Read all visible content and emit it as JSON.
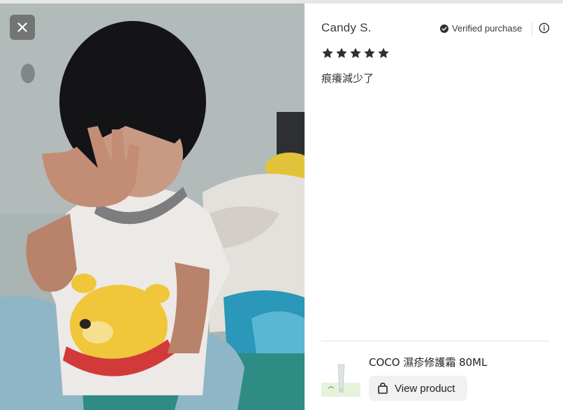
{
  "review": {
    "reviewer_name": "Candy S.",
    "verified_label": "Verified purchase",
    "rating": 5,
    "rating_max": 5,
    "text": "痕癢減少了",
    "icons": {
      "verified": "check-circle-icon",
      "info": "info-circle-icon",
      "star": "star-icon"
    }
  },
  "photo": {
    "close_icon": "close-icon"
  },
  "product": {
    "name": "COCO 濕疹修護霜 80ML",
    "view_label": "View product",
    "view_icon": "shopping-bag-icon"
  },
  "colors": {
    "text": "#2f2f2f",
    "star": "#2f2f2f",
    "button_bg": "#f1f1f1",
    "close_bg": "#5a5a5a"
  }
}
